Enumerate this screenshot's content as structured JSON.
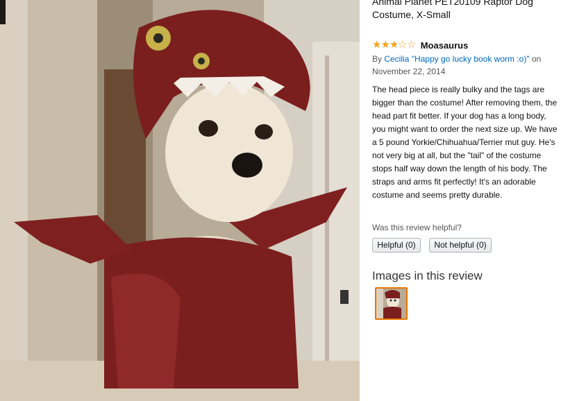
{
  "product": {
    "title": "Animal Planet PET20109 Raptor Dog Costume, X-Small"
  },
  "review": {
    "rating": 3,
    "rating_max": 5,
    "title": "Moasaurus",
    "byline_prefix": "By ",
    "author": "Cecilia \"Happy go lucky book worm :o)\"",
    "date_text": " on November 22, 2014",
    "body": "The head piece is really bulky and the tags are bigger than the costume! After removing them, the head part fit better. If your dog has a long body, you might want to order the next size up. We have a 5 pound Yorkie/Chihuahua/Terrier mut guy. He's not very big at all, but the \"tail\" of the costume stops half way down the length of his body. The straps and arms fit perfectly! It's an adorable costume and seems pretty durable.",
    "helpful_question": "Was this review helpful?",
    "helpful_yes_label": "Helpful (0)",
    "helpful_no_label": "Not helpful (0)"
  },
  "images_section": {
    "heading": "Images in this review"
  },
  "colors": {
    "star": "#f4a41c",
    "link": "#0066c0",
    "thumb_border": "#e77600",
    "costume": "#7a1e1e"
  }
}
